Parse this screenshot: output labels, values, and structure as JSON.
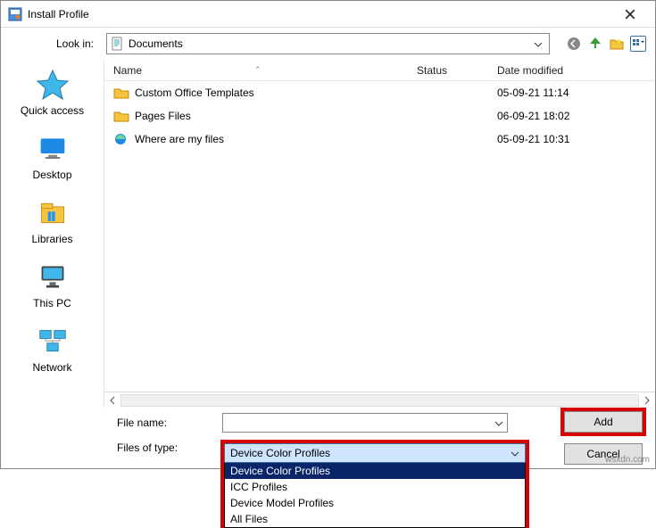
{
  "window": {
    "title": "Install Profile"
  },
  "lookin": {
    "label": "Look in:",
    "value": "Documents"
  },
  "places": [
    {
      "id": "quick-access",
      "label": "Quick access",
      "icon": "star"
    },
    {
      "id": "desktop",
      "label": "Desktop",
      "icon": "desktop"
    },
    {
      "id": "libraries",
      "label": "Libraries",
      "icon": "libraries"
    },
    {
      "id": "this-pc",
      "label": "This PC",
      "icon": "pc"
    },
    {
      "id": "network",
      "label": "Network",
      "icon": "network"
    }
  ],
  "columns": {
    "name": "Name",
    "status": "Status",
    "date": "Date modified"
  },
  "files": [
    {
      "name": "Custom Office Templates",
      "type": "folder",
      "status": "",
      "date": "05-09-21 11:14"
    },
    {
      "name": "Pages Files",
      "type": "folder",
      "status": "",
      "date": "06-09-21 18:02"
    },
    {
      "name": "Where are my files",
      "type": "edge",
      "status": "",
      "date": "05-09-21 10:31"
    }
  ],
  "form": {
    "filename_label": "File name:",
    "filename_value": "",
    "filetype_label": "Files of type:",
    "filetype_value": "Device Color Profiles",
    "filetype_options": [
      "Device Color Profiles",
      "ICC Profiles",
      "Device Model Profiles",
      "All Files"
    ],
    "add_label": "Add",
    "cancel_label": "Cancel"
  },
  "watermark": "wsxdn.com"
}
